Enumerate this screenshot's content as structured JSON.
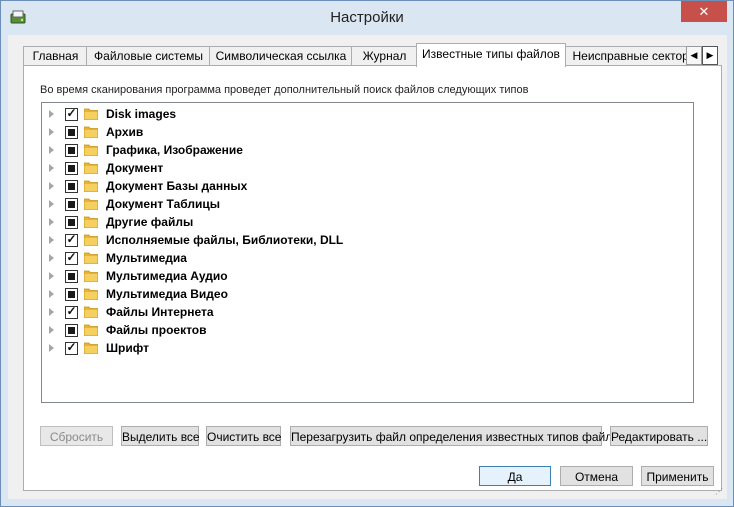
{
  "window": {
    "title": "Настройки",
    "close_symbol": "✕",
    "icon": "app-disk-icon"
  },
  "tabs": [
    {
      "label": "Главная",
      "active": false
    },
    {
      "label": "Файловые системы",
      "active": false
    },
    {
      "label": "Символическая ссылка",
      "active": false
    },
    {
      "label": "Журнал",
      "active": false
    },
    {
      "label": "Известные типы файлов",
      "active": true
    },
    {
      "label": "Неисправные сектора",
      "active": false
    }
  ],
  "tab_scroll": {
    "prev": "◀",
    "next": "▶"
  },
  "description": "Во время сканирования программа проведет дополнительный поиск файлов следующих типов",
  "file_types": [
    {
      "label": "Disk images",
      "state": "checked"
    },
    {
      "label": "Архив",
      "state": "partial"
    },
    {
      "label": "Графика, Изображение",
      "state": "partial"
    },
    {
      "label": "Документ",
      "state": "partial"
    },
    {
      "label": "Документ Базы данных",
      "state": "partial"
    },
    {
      "label": "Документ Таблицы",
      "state": "partial"
    },
    {
      "label": "Другие файлы",
      "state": "partial"
    },
    {
      "label": "Исполняемые файлы, Библиотеки, DLL",
      "state": "checked"
    },
    {
      "label": "Мультимедиа",
      "state": "checked"
    },
    {
      "label": "Мультимедиа Аудио",
      "state": "partial"
    },
    {
      "label": "Мультимедиа Видео",
      "state": "partial"
    },
    {
      "label": "Файлы Интернета",
      "state": "checked"
    },
    {
      "label": "Файлы проектов",
      "state": "partial"
    },
    {
      "label": "Шрифт",
      "state": "checked"
    }
  ],
  "actions": {
    "reset": "Сбросить",
    "select_all": "Выделить все",
    "clear_all": "Очистить все",
    "reload": "Перезагрузить файл определения известных типов файлов",
    "edit": "Редактировать ..."
  },
  "dialog": {
    "ok": "Да",
    "cancel": "Отмена",
    "apply": "Применить"
  },
  "colors": {
    "folder": "#e8b52f",
    "close": "#c7504b",
    "accent": "#3c7fb1"
  }
}
